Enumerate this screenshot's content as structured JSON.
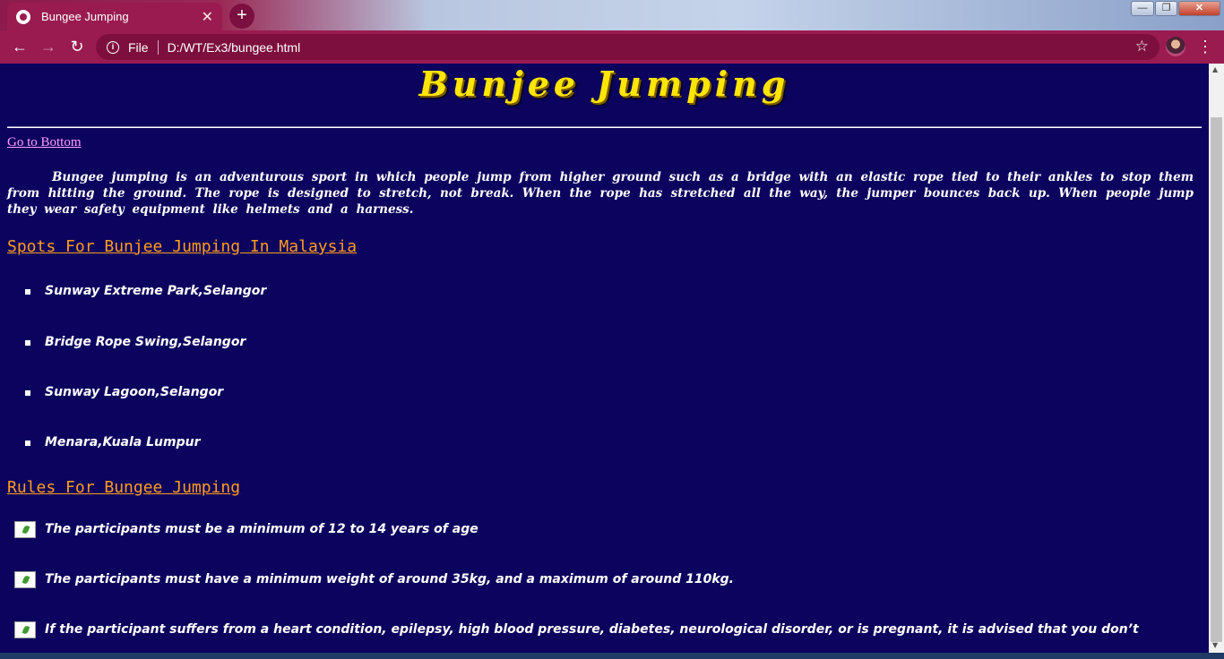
{
  "browser": {
    "tab_title": "Bungee Jumping",
    "tab_close": "✕",
    "new_tab": "+",
    "file_label": "File",
    "url": "D:/WT/Ex3/bungee.html",
    "window_controls": {
      "minimize": "—",
      "maximize": "❐",
      "close": "✕"
    },
    "back": "←",
    "forward": "→",
    "reload": "↻",
    "info": "i",
    "star": "☆",
    "menu": "⋮"
  },
  "page": {
    "title": "Bunjee Jumping",
    "goto_link": "Go to Bottom",
    "intro": "Bungee jumping is an adventurous sport in which people jump from higher ground such as a bridge with an elastic rope tied to their ankles to stop them from hitting the ground. The rope is designed to stretch, not break. When the rope has stretched all the way, the jumper bounces back up. When people jump they wear safety equipment like helmets and a harness.",
    "spots_heading": "Spots For Bunjee Jumping In Malaysia",
    "spots": [
      "Sunway Extreme Park,Selangor",
      "Bridge Rope Swing,Selangor",
      "Sunway Lagoon,Selangor",
      "Menara,Kuala Lumpur"
    ],
    "rules_heading": "Rules For Bungee Jumping",
    "rules": [
      "The participants must be a minimum of 12 to 14 years of age",
      "The participants must have a minimum weight of around 35kg, and a maximum of around 110kg.",
      "If the participant suffers from a heart condition, epilepsy, high blood pressure, diabetes, neurological disorder, or is pregnant, it is advised that you don’t"
    ]
  },
  "colors": {
    "page_background": "#0c035e",
    "title": "#ffe600",
    "heading": "#ff9d1e",
    "link": "#ff9cff",
    "chrome": "#9a1b4f"
  }
}
